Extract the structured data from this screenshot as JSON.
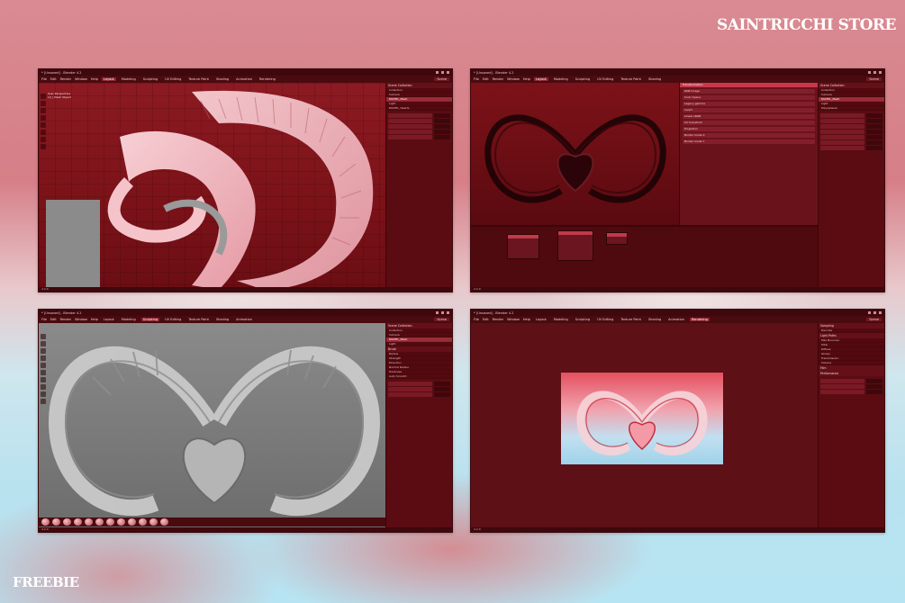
{
  "brand": {
    "store_name": "SAINTRICCHI STORE",
    "freebie_label": "FREEBIE"
  },
  "colors": {
    "accent": "#8f2430",
    "window_bg": "#5d1016",
    "highlight": "#c7384a"
  },
  "window_top_left": {
    "title": "* [Unsaved] - Blender 4.2",
    "menus": [
      "File",
      "Edit",
      "Render",
      "Window",
      "Help"
    ],
    "workspaces": [
      "Layout",
      "Modeling",
      "Sculpting",
      "UV Editing",
      "Texture Paint",
      "Shading",
      "Animation",
      "Rendering",
      "Compositing",
      "Geometry Nodes",
      "Scripting"
    ],
    "active_workspace": "Layout",
    "scene_label": "Scene",
    "overlay_text": "User Perspective\n(1) | Mesh Object",
    "outliner_header": "Scene Collection",
    "outliner_rows": [
      "Collection",
      "Camera",
      "PASTEL_Mesh",
      "Light",
      "PASTEL_Hearts"
    ],
    "status": "4.2.0"
  },
  "window_top_right": {
    "title": "* [Unsaved] - Blender 4.2",
    "menus": [
      "File",
      "Edit",
      "Render",
      "Window",
      "Help"
    ],
    "workspaces": [
      "Layout",
      "Modeling",
      "Sculpting",
      "UV Editing",
      "Texture Paint",
      "Shading",
      "Animation",
      "Rendering",
      "Compositing"
    ],
    "active_workspace": "Layout",
    "scene_label": "Scene",
    "node_panel_title": "RGB Image",
    "node_panel_header": "Transformation",
    "node_rows": [
      "Color Space",
      "Legacy gamma",
      "Invert",
      "Linear sRGB",
      "UV transform",
      "Projection",
      "Border mode X",
      "Border mode Y"
    ],
    "outliner_header": "Scene Collection",
    "outliner_rows": [
      "Collection",
      "Camera",
      "PASTEL_Mesh",
      "Light",
      "Polyspheres"
    ],
    "status": "4.2.0"
  },
  "window_bottom_left": {
    "title": "* [Unsaved] - Blender 4.2",
    "menus": [
      "File",
      "Edit",
      "Render",
      "Window",
      "Help"
    ],
    "workspaces": [
      "Layout",
      "Modeling",
      "Sculpting",
      "UV Editing",
      "Texture Paint",
      "Shading",
      "Animation",
      "Rendering",
      "Compositing",
      "Geometry Nodes",
      "Scripting"
    ],
    "active_workspace": "Sculpting",
    "scene_label": "Scene",
    "outliner_header": "Scene Collection",
    "outliner_rows": [
      "Collection",
      "Camera",
      "PASTEL_Mesh",
      "Light"
    ],
    "panel_rows": [
      "Brush",
      "Radius",
      "Strength",
      "Direction",
      "Normal Radius",
      "Hardness",
      "Auto Smooth"
    ],
    "status": "4.2.0"
  },
  "window_bottom_right": {
    "title": "* [Unsaved] - Blender 4.2",
    "menus": [
      "File",
      "Edit",
      "Render",
      "Window",
      "Help"
    ],
    "workspaces": [
      "Layout",
      "Modeling",
      "Sculpting",
      "UV Editing",
      "Texture Paint",
      "Shading",
      "Animation",
      "Rendering",
      "Compositing",
      "Geometry Nodes",
      "Scripting"
    ],
    "active_workspace": "Rendering",
    "scene_label": "Scene",
    "panel_rows": [
      "Sampling",
      "Denoise",
      "Light Paths",
      "Max Bounces",
      "Total",
      "Diffuse",
      "Glossy",
      "Transmission",
      "Volume",
      "Film",
      "Performance"
    ],
    "status": "4.2.0"
  }
}
